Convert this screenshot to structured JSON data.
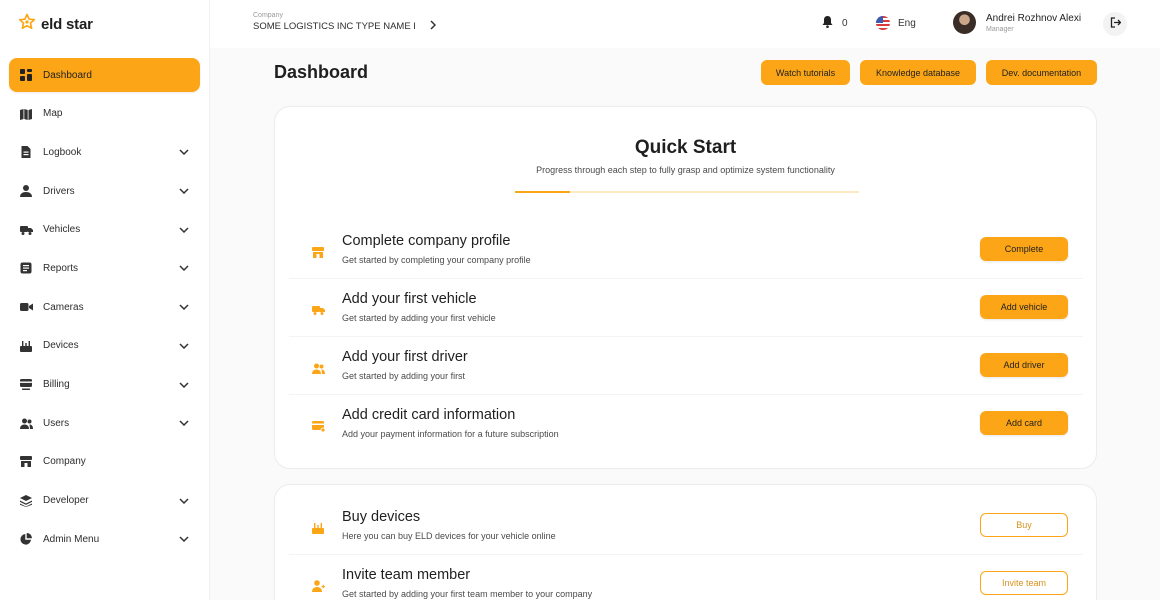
{
  "brand": {
    "name": "eld star",
    "accent": "#fca617"
  },
  "sidebar": {
    "items": [
      {
        "label": "Dashboard",
        "icon": "dashboard-icon",
        "active": true,
        "expandable": false
      },
      {
        "label": "Map",
        "icon": "map-icon",
        "active": false,
        "expandable": false
      },
      {
        "label": "Logbook",
        "icon": "logbook-icon",
        "active": false,
        "expandable": true
      },
      {
        "label": "Drivers",
        "icon": "driver-icon",
        "active": false,
        "expandable": true
      },
      {
        "label": "Vehicles",
        "icon": "truck-icon",
        "active": false,
        "expandable": true
      },
      {
        "label": "Reports",
        "icon": "reports-icon",
        "active": false,
        "expandable": true
      },
      {
        "label": "Cameras",
        "icon": "camera-icon",
        "active": false,
        "expandable": true
      },
      {
        "label": "Devices",
        "icon": "devices-icon",
        "active": false,
        "expandable": true
      },
      {
        "label": "Billing",
        "icon": "billing-icon",
        "active": false,
        "expandable": true
      },
      {
        "label": "Users",
        "icon": "users-icon",
        "active": false,
        "expandable": true
      },
      {
        "label": "Company",
        "icon": "store-icon",
        "active": false,
        "expandable": false
      },
      {
        "label": "Developer",
        "icon": "layers-icon",
        "active": false,
        "expandable": true
      },
      {
        "label": "Admin Menu",
        "icon": "pie-chart-icon",
        "active": false,
        "expandable": true
      }
    ]
  },
  "topbar": {
    "company_caption": "Company",
    "company_name": "SOME LOGISTICS INC TYPE NAME I",
    "notifications_count": "0",
    "language": "Eng",
    "user_name": "Andrei Rozhnov Alexi",
    "user_role": "Manager"
  },
  "header": {
    "title": "Dashboard",
    "buttons": [
      "Watch tutorials",
      "Knowledge database",
      "Dev. documentation"
    ]
  },
  "quick_start": {
    "title": "Quick Start",
    "subtitle": "Progress through each step to fully grasp and optimize system functionality",
    "progress": 0.16,
    "steps": [
      {
        "title": "Complete company profile",
        "subtitle": "Get started by completing your company profile",
        "button": "Complete",
        "icon": "store-icon"
      },
      {
        "title": "Add your first vehicle",
        "subtitle": "Get started by adding your first vehicle",
        "button": "Add vehicle",
        "icon": "truck-icon"
      },
      {
        "title": "Add your first driver",
        "subtitle": "Get started by adding your first",
        "button": "Add driver",
        "icon": "users-icon"
      },
      {
        "title": "Add credit card information",
        "subtitle": "Add your payment information for a future subscription",
        "button": "Add card",
        "icon": "credit-card-icon"
      }
    ]
  },
  "more_actions": {
    "items": [
      {
        "title": "Buy devices",
        "subtitle": "Here you can buy ELD devices for your vehicle online",
        "button": "Buy",
        "icon": "devices-icon"
      },
      {
        "title": "Invite team member",
        "subtitle": "Get started by adding your first team member to your company",
        "button": "Invite team",
        "icon": "add-user-icon"
      }
    ]
  }
}
